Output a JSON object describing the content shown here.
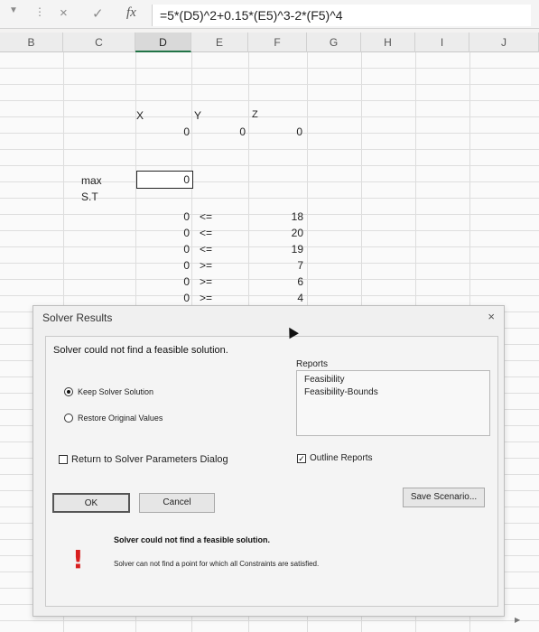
{
  "formula_bar": {
    "cancel_icon": "×",
    "enter_icon": "✓",
    "fx_label": "fx",
    "formula": "=5*(D5)^2+0.15*(E5)^3-2*(F5)^4"
  },
  "columns": [
    "B",
    "C",
    "D",
    "E",
    "F",
    "G",
    "H",
    "I",
    "J"
  ],
  "sheet": {
    "var_headers": {
      "x": "X",
      "y": "Y",
      "z": "Z"
    },
    "var_values": {
      "x": "0",
      "y": "0",
      "z": "0"
    },
    "max_label": "max",
    "st_label": "S.T",
    "objective_value": "0",
    "constraints": [
      {
        "lhs": "0",
        "op": "<=",
        "rhs": "18"
      },
      {
        "lhs": "0",
        "op": "<=",
        "rhs": "20"
      },
      {
        "lhs": "0",
        "op": "<=",
        "rhs": "19"
      },
      {
        "lhs": "0",
        "op": ">=",
        "rhs": "7"
      },
      {
        "lhs": "0",
        "op": ">=",
        "rhs": "6"
      },
      {
        "lhs": "0",
        "op": ">=",
        "rhs": "4"
      }
    ]
  },
  "dialog": {
    "title": "Solver Results",
    "close_icon": "×",
    "status_message": "Solver could not find a feasible solution.",
    "keep_solution_label": "Keep Solver Solution",
    "restore_values_label": "Restore Original Values",
    "return_dialog_label": "Return to Solver Parameters Dialog",
    "reports_label": "Reports",
    "reports": [
      "Feasibility",
      "Feasibility-Bounds"
    ],
    "outline_reports_label": "Outline Reports",
    "ok_label": "OK",
    "cancel_label": "Cancel",
    "save_scenario_label": "Save Scenario...",
    "footer_heading": "Solver could not find a feasible solution.",
    "footer_detail": "Solver can not find a point for which all Constraints are satisfied.",
    "warning_icon": "!"
  },
  "colors": {
    "warning": "#d81e1e",
    "active_column_accent": "#217346"
  }
}
